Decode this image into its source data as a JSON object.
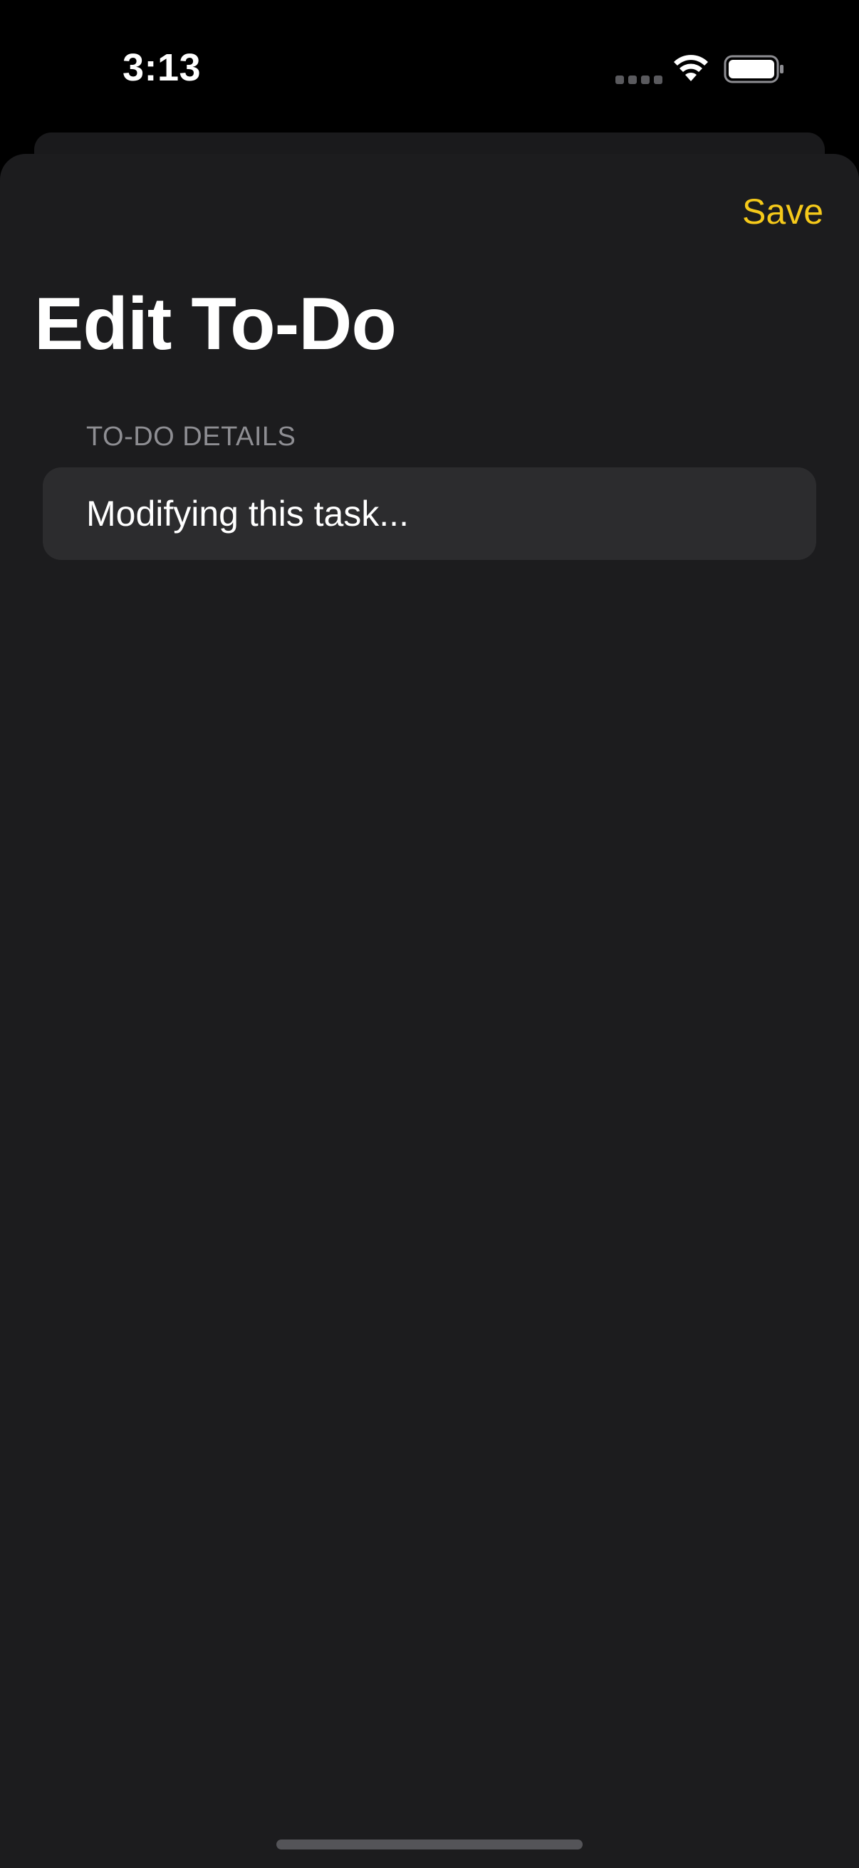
{
  "status_bar": {
    "time": "3:13",
    "icons": [
      "signal-dots-icon",
      "wifi-icon",
      "battery-icon"
    ]
  },
  "nav": {
    "save_label": "Save"
  },
  "page": {
    "title": "Edit To-Do"
  },
  "form": {
    "section_header": "TO-DO DETAILS",
    "task_field": {
      "value": "Modifying this task...",
      "placeholder": ""
    }
  },
  "colors": {
    "accent": "#f5c91a",
    "background": "#1c1c1e",
    "field_background": "#2c2c2e",
    "secondary_text": "#8e8e93"
  }
}
